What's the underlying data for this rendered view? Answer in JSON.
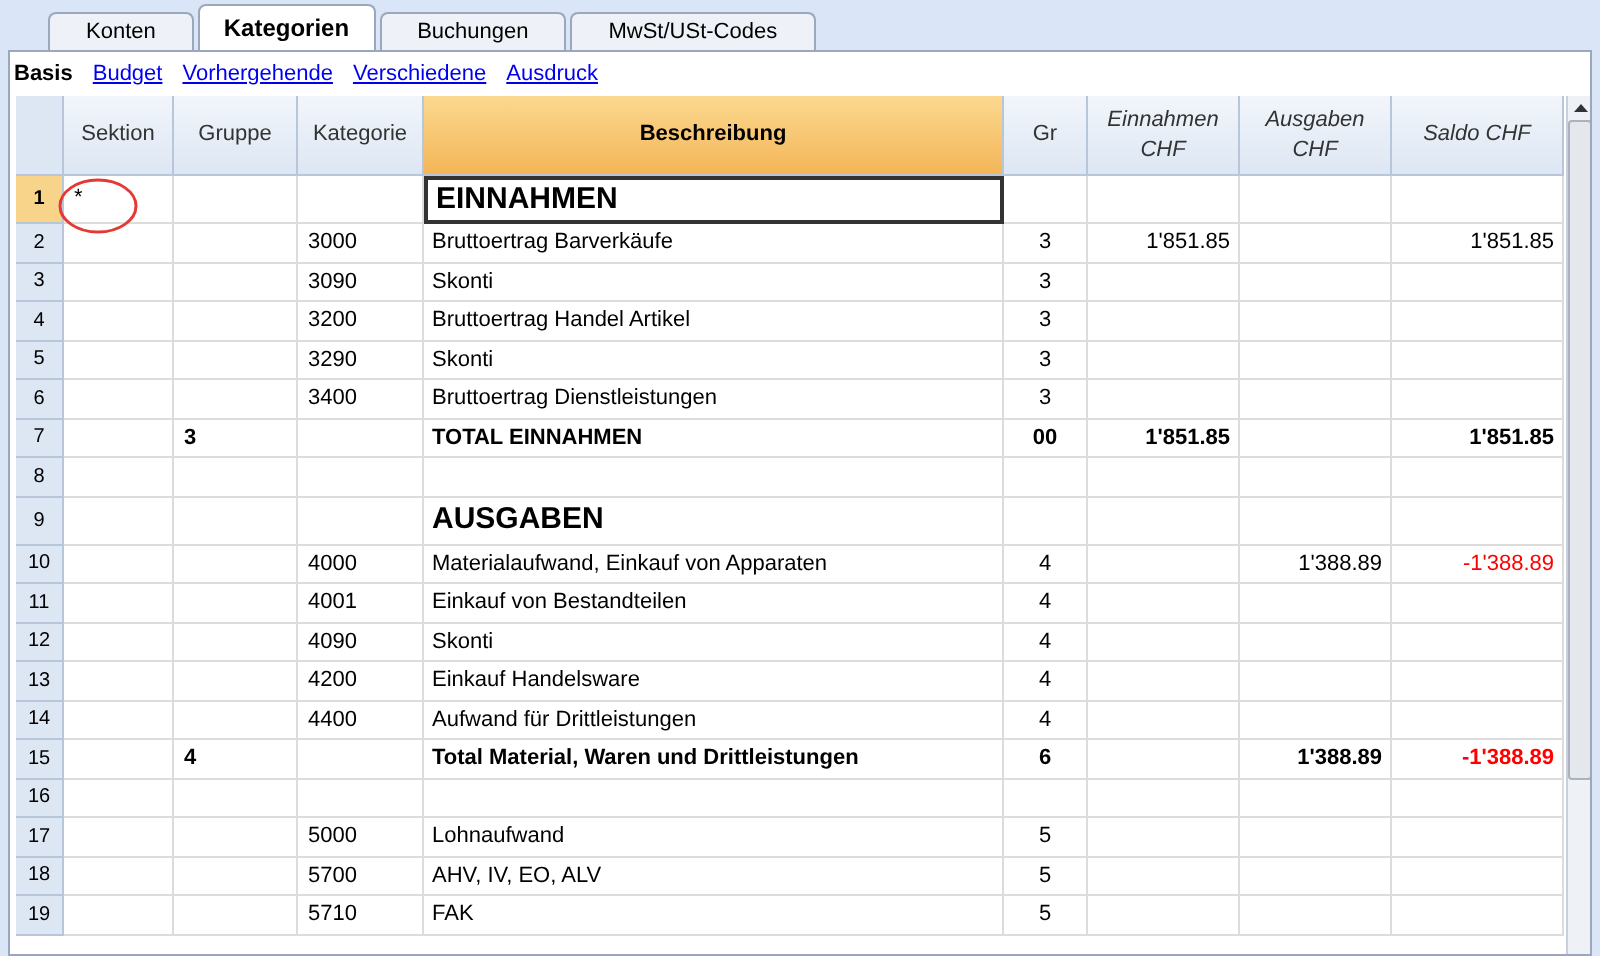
{
  "tabs": [
    {
      "label": "Konten",
      "selected": false
    },
    {
      "label": "Kategorien",
      "selected": true
    },
    {
      "label": "Buchungen",
      "selected": false
    },
    {
      "label": "MwSt/USt-Codes",
      "selected": false
    }
  ],
  "views": [
    {
      "label": "Basis",
      "selected": true
    },
    {
      "label": "Budget",
      "selected": false
    },
    {
      "label": "Vorhergehende",
      "selected": false
    },
    {
      "label": "Verschiedene",
      "selected": false
    },
    {
      "label": "Ausdruck",
      "selected": false
    }
  ],
  "table": {
    "columns": [
      {
        "label": "Sektion",
        "selected": false,
        "italic": false
      },
      {
        "label": "Gruppe",
        "selected": false,
        "italic": false
      },
      {
        "label": "Kategorie",
        "selected": false,
        "italic": false
      },
      {
        "label": "Beschreibung",
        "selected": true,
        "italic": false
      },
      {
        "label": "Gr",
        "selected": false,
        "italic": false
      },
      {
        "label": "Einnahmen CHF",
        "selected": false,
        "italic": true
      },
      {
        "label": "Ausgaben CHF",
        "selected": false,
        "italic": true
      },
      {
        "label": "Saldo CHF",
        "selected": false,
        "italic": true
      }
    ],
    "rows": [
      {
        "number": "1",
        "kind": "heading",
        "selected": true,
        "cells": [
          "*",
          "",
          "",
          "EINNAHMEN",
          "",
          "",
          "",
          ""
        ],
        "negative": false
      },
      {
        "number": "2",
        "kind": "normal",
        "selected": false,
        "cells": [
          "",
          "",
          "3000",
          "Bruttoertrag Barverkäufe",
          "3",
          "1'851.85",
          "",
          "1'851.85"
        ],
        "negative": false
      },
      {
        "number": "3",
        "kind": "normal",
        "selected": false,
        "cells": [
          "",
          "",
          "3090",
          "Skonti",
          "3",
          "",
          "",
          ""
        ],
        "negative": false
      },
      {
        "number": "4",
        "kind": "normal",
        "selected": false,
        "cells": [
          "",
          "",
          "3200",
          "Bruttoertrag Handel Artikel",
          "3",
          "",
          "",
          ""
        ],
        "negative": false
      },
      {
        "number": "5",
        "kind": "normal",
        "selected": false,
        "cells": [
          "",
          "",
          "3290",
          "Skonti",
          "3",
          "",
          "",
          ""
        ],
        "negative": false
      },
      {
        "number": "6",
        "kind": "normal",
        "selected": false,
        "cells": [
          "",
          "",
          "3400",
          "Bruttoertrag Dienstleistungen",
          "3",
          "",
          "",
          ""
        ],
        "negative": false
      },
      {
        "number": "7",
        "kind": "total",
        "selected": false,
        "cells": [
          "",
          "3",
          "",
          "TOTAL EINNAHMEN",
          "00",
          "1'851.85",
          "",
          "1'851.85"
        ],
        "negative": false
      },
      {
        "number": "8",
        "kind": "normal",
        "selected": false,
        "cells": [
          "",
          "",
          "",
          "",
          "",
          "",
          "",
          ""
        ],
        "negative": false
      },
      {
        "number": "9",
        "kind": "heading",
        "selected": false,
        "cells": [
          "",
          "",
          "",
          "AUSGABEN",
          "",
          "",
          "",
          ""
        ],
        "negative": false
      },
      {
        "number": "10",
        "kind": "normal",
        "selected": false,
        "cells": [
          "",
          "",
          "4000",
          "Materialaufwand, Einkauf von Apparaten",
          "4",
          "",
          "1'388.89",
          "-1'388.89"
        ],
        "negative": true
      },
      {
        "number": "11",
        "kind": "normal",
        "selected": false,
        "cells": [
          "",
          "",
          "4001",
          "Einkauf von Bestandteilen",
          "4",
          "",
          "",
          ""
        ],
        "negative": false
      },
      {
        "number": "12",
        "kind": "normal",
        "selected": false,
        "cells": [
          "",
          "",
          "4090",
          "Skonti",
          "4",
          "",
          "",
          ""
        ],
        "negative": false
      },
      {
        "number": "13",
        "kind": "normal",
        "selected": false,
        "cells": [
          "",
          "",
          "4200",
          "Einkauf Handelsware",
          "4",
          "",
          "",
          ""
        ],
        "negative": false
      },
      {
        "number": "14",
        "kind": "normal",
        "selected": false,
        "cells": [
          "",
          "",
          "4400",
          "Aufwand für Drittleistungen",
          "4",
          "",
          "",
          ""
        ],
        "negative": false
      },
      {
        "number": "15",
        "kind": "total",
        "selected": false,
        "cells": [
          "",
          "4",
          "",
          "Total Material, Waren und Drittleistungen",
          "6",
          "",
          "1'388.89",
          "-1'388.89"
        ],
        "negative": true
      },
      {
        "number": "16",
        "kind": "normal",
        "selected": false,
        "cells": [
          "",
          "",
          "",
          "",
          "",
          "",
          "",
          ""
        ],
        "negative": false
      },
      {
        "number": "17",
        "kind": "normal",
        "selected": false,
        "cells": [
          "",
          "",
          "5000",
          "Lohnaufwand",
          "5",
          "",
          "",
          ""
        ],
        "negative": false
      },
      {
        "number": "18",
        "kind": "normal",
        "selected": false,
        "cells": [
          "",
          "",
          "5700",
          "AHV, IV, EO, ALV",
          "5",
          "",
          "",
          ""
        ],
        "negative": false
      },
      {
        "number": "19",
        "kind": "normal",
        "selected": false,
        "cells": [
          "",
          "",
          "5710",
          "FAK",
          "5",
          "",
          "",
          ""
        ],
        "negative": false
      }
    ]
  }
}
